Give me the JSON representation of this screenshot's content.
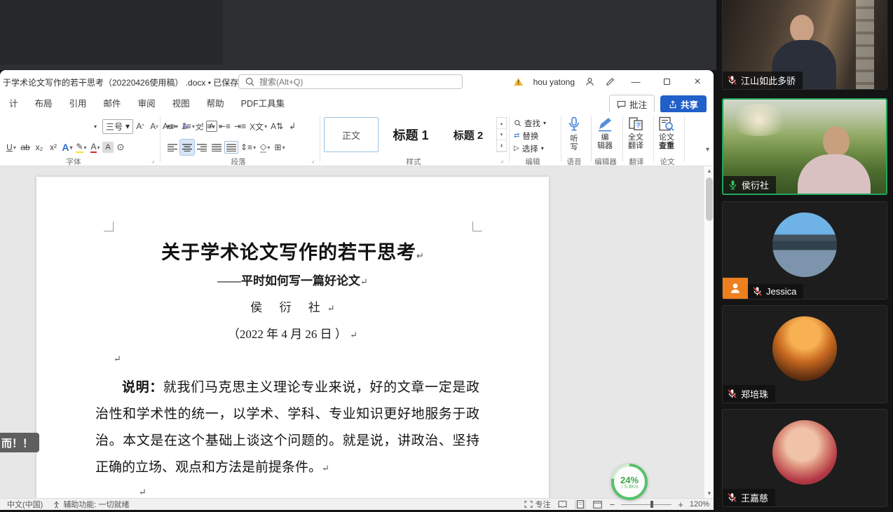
{
  "word": {
    "titlebar": {
      "document_title": "于学术论文写作的若干思考（20220426使用稿） .docx",
      "saved_status": "• 已保存到这台电脑",
      "search_placeholder": "搜索(Alt+Q)",
      "account_name": "hou yatong"
    },
    "actions": {
      "comments": "批注",
      "share": "共享"
    },
    "tabs": [
      "计",
      "布局",
      "引用",
      "邮件",
      "审阅",
      "视图",
      "帮助",
      "PDF工具集"
    ],
    "ribbon": {
      "font_size": "三号",
      "group_font": "字体",
      "group_paragraph": "段落",
      "group_styles": "样式",
      "group_editing": "编辑",
      "group_voice": "语音",
      "group_editor": "编辑器",
      "group_translate": "翻译",
      "group_paper": "论文",
      "style_normal": "正文",
      "style_h1": "标题 1",
      "style_h2": "标题 2",
      "find": "查找",
      "replace": "替换",
      "select": "选择",
      "dictate_l1": "听",
      "dictate_l2": "写",
      "editor_l1": "编",
      "editor_l2": "辑器",
      "translate_l1": "全文",
      "translate_l2": "翻译",
      "paper_l1": "论文",
      "paper_l2": "查重"
    },
    "document": {
      "title": "关于学术论文写作的若干思考",
      "subtitle": "——平时如何写一篇好论文",
      "author": "侯 衍 社",
      "date": "（2022 年 4 月 26 日 ）",
      "body_lead": "说明：",
      "body": "就我们马克思主义理论专业来说，好的文章一定是政治性和学术性的统一，以学术、学科、专业知识更好地服务于政治。本文是在这个基础上谈这个问题的。就是说，讲政治、坚持正确的立场、观点和方法是前提条件。",
      "pilcrow": "↵"
    },
    "statusbar": {
      "language": "中文(中国)",
      "accessibility": "辅助功能: 一切就绪",
      "focus": "专注",
      "zoom_level": "120%"
    },
    "overlay": {
      "tooltip": "而！！"
    },
    "widget": {
      "percent": "24%",
      "speed": "↓ 5.8K/s"
    }
  },
  "meeting": {
    "participants": [
      {
        "name": "江山如此多骄",
        "mic": "muted"
      },
      {
        "name": "侯衍社",
        "mic": "on"
      },
      {
        "name": "Jessica",
        "mic": "muted"
      },
      {
        "name": "郑培珠",
        "mic": "muted"
      },
      {
        "name": "王嘉慈",
        "mic": "muted"
      }
    ]
  },
  "colors": {
    "share_blue": "#2160c9",
    "active_green": "#21a65a",
    "badge_orange": "#ee7f1e"
  }
}
